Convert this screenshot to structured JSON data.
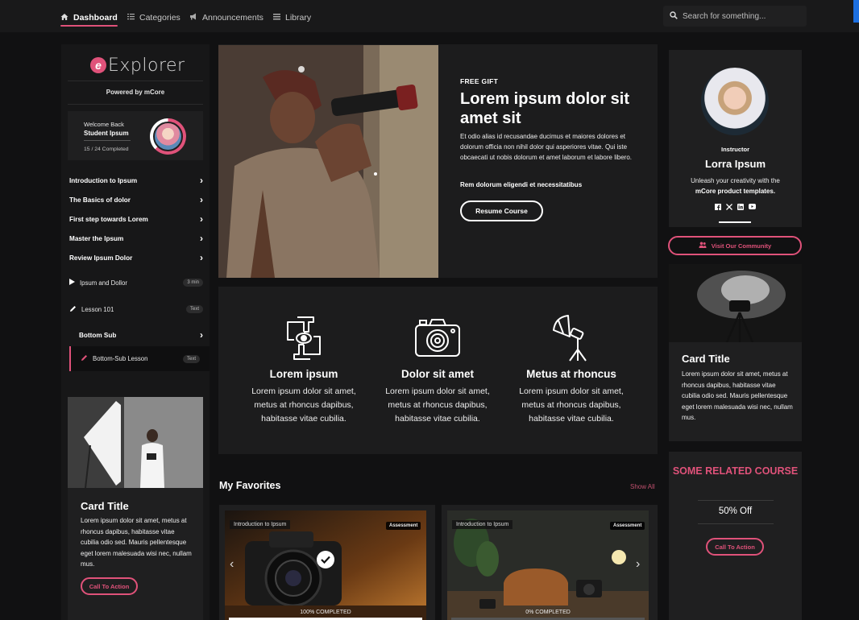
{
  "nav": {
    "items": [
      {
        "label": "Dashboard",
        "icon": "home-icon",
        "active": true
      },
      {
        "label": "Categories",
        "icon": "list-icon",
        "active": false
      },
      {
        "label": "Announcements",
        "icon": "megaphone-icon",
        "active": false
      },
      {
        "label": "Library",
        "icon": "library-icon",
        "active": false
      }
    ],
    "search_placeholder": "Search for something..."
  },
  "sidebar": {
    "logo_letter": "e",
    "logo_text": "Explorer",
    "powered_by": "Powered by mCore",
    "welcome": {
      "greeting": "Welcome Back",
      "name": "Student Ipsum",
      "progress_text": "15 / 24 Completed",
      "progress_fraction": 0.625
    },
    "menu": [
      {
        "label": "Introduction to Ipsum"
      },
      {
        "label": "The Basics of dolor"
      },
      {
        "label": "First step towards Lorem"
      },
      {
        "label": "Master the Ipsum"
      },
      {
        "label": "Review Ipsum Dolor"
      }
    ],
    "lessons": [
      {
        "label": "Ipsum and Dollor",
        "badge": "3 min",
        "icon": "play-icon"
      },
      {
        "label": "Lesson 101",
        "badge": "Text",
        "icon": "pencil-icon"
      }
    ],
    "bottom_sub": "Bottom Sub",
    "bottom_sub_lesson": {
      "label": "Bottom-Sub Lesson",
      "badge": "Text"
    },
    "card": {
      "title": "Card Title",
      "text": "Lorem ipsum dolor sit amet, metus at rhoncus dapibus, habitasse vitae cubilia odio sed. Mauris pellentesque eget lorem malesuada wisi nec, nullam mus.",
      "cta": "Call To Action"
    }
  },
  "hero": {
    "eyebrow": "FREE GIFT",
    "title": "Lorem ipsum dolor sit amet sit",
    "body": "Et odio alias id recusandae ducimus et maiores dolores et dolorum officia non nihil dolor qui asperiores vitae. Qui iste obcaecati ut nobis dolorum et amet laborum et labore libero.",
    "strong": "Rem dolorum eligendi et necessitatibus",
    "button": "Resume Course"
  },
  "features": [
    {
      "title": "Lorem ipsum",
      "text": "Lorem ipsum dolor sit amet, metus at rhoncus dapibus, habitasse vitae cubilia.",
      "icon": "frame-hands-icon"
    },
    {
      "title": "Dolor sit amet",
      "text": "Lorem ipsum dolor sit amet, metus at rhoncus dapibus, habitasse vitae cubilia.",
      "icon": "camera-icon"
    },
    {
      "title": "Metus at rhoncus",
      "text": "Lorem ipsum dolor sit amet, metus at rhoncus dapibus, habitasse vitae cubilia.",
      "icon": "studio-umbrella-icon"
    }
  ],
  "favorites": {
    "heading": "My Favorites",
    "show_all": "Show All",
    "cards": [
      {
        "tag": "Introduction to Ipsum",
        "type": "Assessment",
        "progress_text": "100% COMPLETED",
        "progress_fraction": 1.0
      },
      {
        "tag": "Introduction to Ipsum",
        "type": "Assessment",
        "progress_text": "0% COMPLETED",
        "progress_fraction": 0.0
      }
    ]
  },
  "instructor": {
    "role": "Instructor",
    "name": "Lorra Ipsum",
    "bio_line1": "Unleash your creativity with the",
    "bio_line2": "mCore product templates.",
    "socials": [
      "f",
      "X",
      "in",
      "yt"
    ],
    "community_button": "Visit Our Community"
  },
  "right_card": {
    "title": "Card Title",
    "text": "Lorem ipsum dolor sit amet, metus at rhoncus dapibus, habitasse vitae cubilia odio sed. Mauris pellentesque eget lorem malesuada wisi nec, nullam mus."
  },
  "related": {
    "title": "SOME RELATED COURSE",
    "price": "50% Off",
    "cta": "Call To Action"
  },
  "colors": {
    "accent": "#e0527a",
    "background": "#111112",
    "panel": "#1f1f20"
  }
}
